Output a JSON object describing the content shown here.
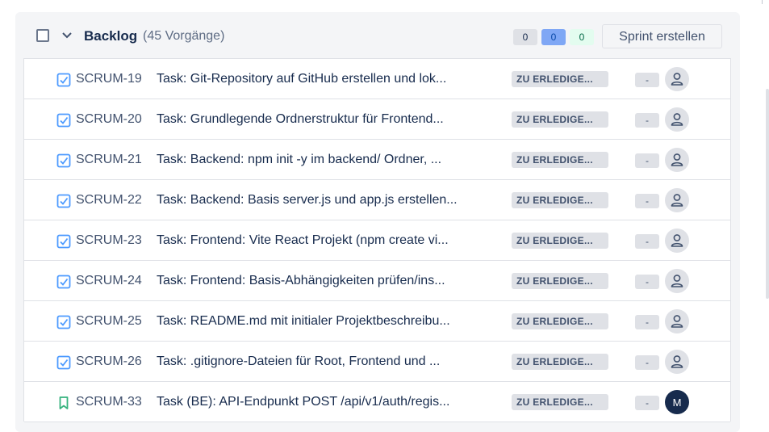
{
  "backlog": {
    "title": "Backlog",
    "count": "(45 Vorgänge)",
    "badges": [
      "0",
      "0",
      "0"
    ],
    "sprint_button": "Sprint erstellen"
  },
  "issues": [
    {
      "key": "SCRUM-19",
      "summary": "Task: Git-Repository auf GitHub erstellen und lok...",
      "status": "ZU ERLEDIGE...",
      "estimate": "-",
      "type": "task",
      "avatar": ""
    },
    {
      "key": "SCRUM-20",
      "summary": "Task: Grundlegende Ordnerstruktur für Frontend...",
      "status": "ZU ERLEDIGE...",
      "estimate": "-",
      "type": "task",
      "avatar": ""
    },
    {
      "key": "SCRUM-21",
      "summary": "Task: Backend: npm init -y im backend/ Ordner, ...",
      "status": "ZU ERLEDIGE...",
      "estimate": "-",
      "type": "task",
      "avatar": ""
    },
    {
      "key": "SCRUM-22",
      "summary": "Task: Backend: Basis server.js und app.js erstellen...",
      "status": "ZU ERLEDIGE...",
      "estimate": "-",
      "type": "task",
      "avatar": ""
    },
    {
      "key": "SCRUM-23",
      "summary": "Task: Frontend: Vite React Projekt (npm create vi...",
      "status": "ZU ERLEDIGE...",
      "estimate": "-",
      "type": "task",
      "avatar": ""
    },
    {
      "key": "SCRUM-24",
      "summary": "Task: Frontend: Basis-Abhängigkeiten prüfen/ins...",
      "status": "ZU ERLEDIGE...",
      "estimate": "-",
      "type": "task",
      "avatar": ""
    },
    {
      "key": "SCRUM-25",
      "summary": "Task: README.md mit initialer Projektbeschreibu...",
      "status": "ZU ERLEDIGE...",
      "estimate": "-",
      "type": "task",
      "avatar": ""
    },
    {
      "key": "SCRUM-26",
      "summary": "Task: .gitignore-Dateien für Root, Frontend und ...",
      "status": "ZU ERLEDIGE...",
      "estimate": "-",
      "type": "task",
      "avatar": ""
    },
    {
      "key": "SCRUM-33",
      "summary": "Task (BE): API-Endpunkt POST /api/v1/auth/regis...",
      "status": "ZU ERLEDIGE...",
      "estimate": "-",
      "type": "story",
      "avatar": "M"
    }
  ],
  "icons": {
    "task": "task-checkbox-icon",
    "story": "story-bookmark-icon",
    "unassigned": "user-icon",
    "collapse": "chevron-down-icon"
  },
  "colors": {
    "task_icon": "#4c9aff",
    "story_icon": "#36b37e",
    "status_bg": "#dfe1e6"
  }
}
